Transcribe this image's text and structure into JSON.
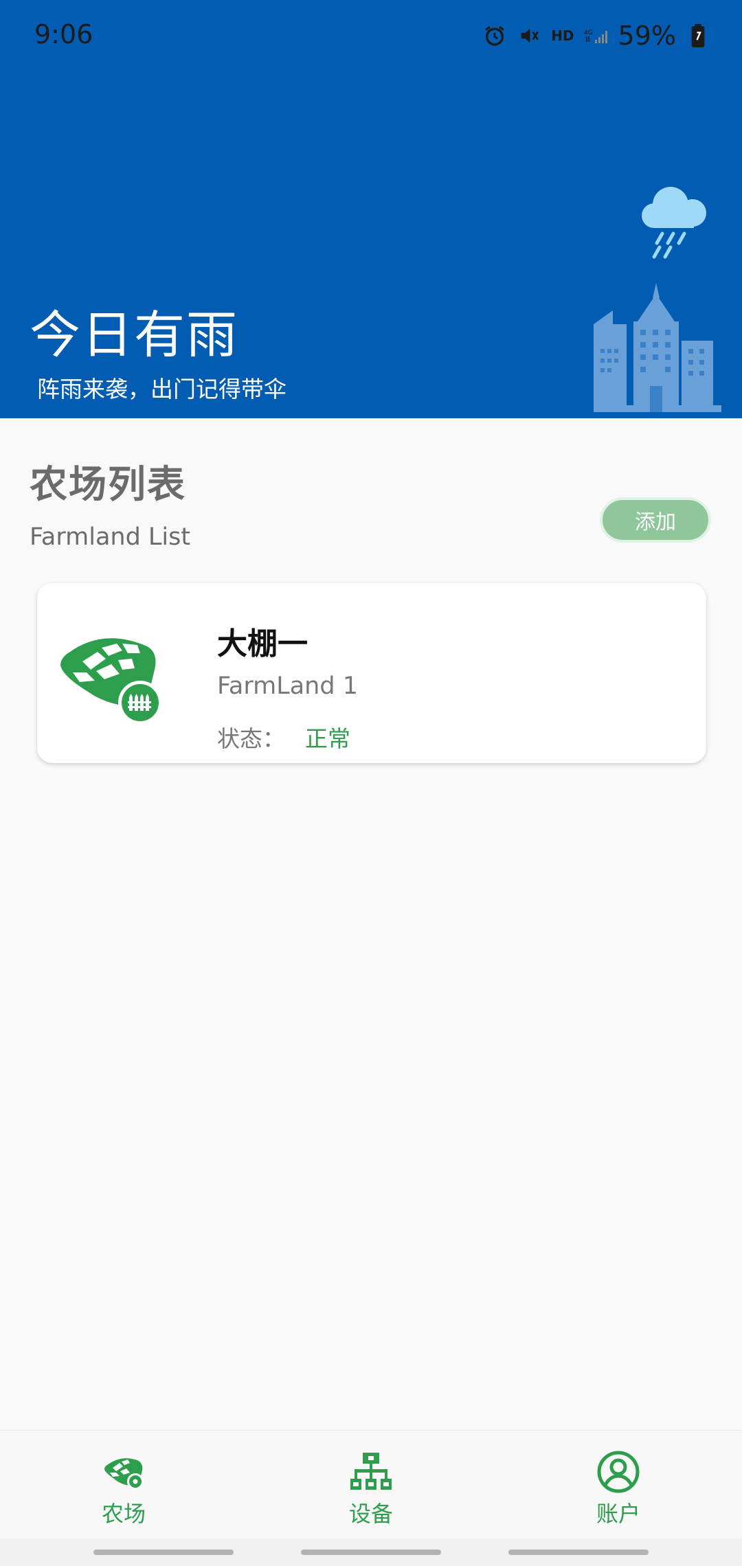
{
  "status_bar": {
    "time": "9:06",
    "battery": "59%",
    "network": "4G",
    "hd": "HD"
  },
  "weather": {
    "title": "今日有雨",
    "subtitle": "阵雨来袭，出门记得带伞",
    "icon": "rain-cloud-icon"
  },
  "list": {
    "title": "农场列表",
    "subtitle": "Farmland List",
    "add_label": "添加"
  },
  "farms": [
    {
      "name": "大棚一",
      "id": "FarmLand 1",
      "status_label": "状态：",
      "status_value": "正常"
    }
  ],
  "bottom_nav": {
    "items": [
      {
        "label": "农场",
        "icon": "farm-icon"
      },
      {
        "label": "设备",
        "icon": "device-network-icon"
      },
      {
        "label": "账户",
        "icon": "account-icon"
      }
    ]
  },
  "colors": {
    "header_bg": "#025cb1",
    "accent_green": "#2d9e4c",
    "add_button": "#8fc79b"
  }
}
